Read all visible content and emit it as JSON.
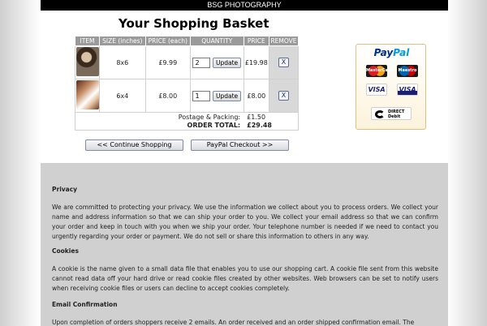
{
  "header": {
    "title": "BSG PHOTOGRAPHY"
  },
  "basket": {
    "title": "Your Shopping Basket",
    "columns": [
      "ITEM",
      "SIZE (inches)",
      "PRICE (each)",
      "QUANTITY",
      "PRICE",
      "REMOVE"
    ],
    "rows": [
      {
        "size": "8x6",
        "price_each": "£9.99",
        "quantity": "2",
        "update_label": "Update",
        "price": "£19.98",
        "remove_label": "X"
      },
      {
        "size": "6x4",
        "price_each": "£8.00",
        "quantity": "1",
        "update_label": "Update",
        "price": "£8.00",
        "remove_label": "X"
      }
    ],
    "postage_label": "Postage & Packing:",
    "postage_value": "£1.50",
    "total_label": "ORDER TOTAL:",
    "total_value": "£29.48"
  },
  "buttons": {
    "continue": "<<  Continue Shopping",
    "checkout": "PayPal Checkout  >>"
  },
  "paypal": {
    "logo_pay": "Pay",
    "logo_pal": "Pal",
    "cards": [
      "MasterCard",
      "Maestro",
      "VISA",
      "VISA"
    ],
    "direct_debit": "DIRECT Debit"
  },
  "info": {
    "privacy_heading": "Privacy",
    "privacy_text": "We are committed to protecting your privacy. We use the information we collect about you to process orders. We collect your name and address information so that we can ship your order to you. We collect your email address so that we can confirm your order and keep in touch with you when we ship your order. Your telephone number is needed if we need to contact you urgently regarding your order or payment. We do not sell or share this information to others in any way.",
    "cookies_heading": "Cookies",
    "cookies_text": "A cookie is the name given to a small data file that enables you to use our shopping cart. A cookie file sent from this website cannot read data off your hard drive or read cookie files created by other websites. Web browsers can be set to notify users when receiving cookie files or users can decline to accept cookies completely.",
    "email_heading": "Email Confirmation",
    "email_text": "Upon completion of orders shoppers receive 2 emails. An order received and an order shipped confirmation email. The"
  }
}
